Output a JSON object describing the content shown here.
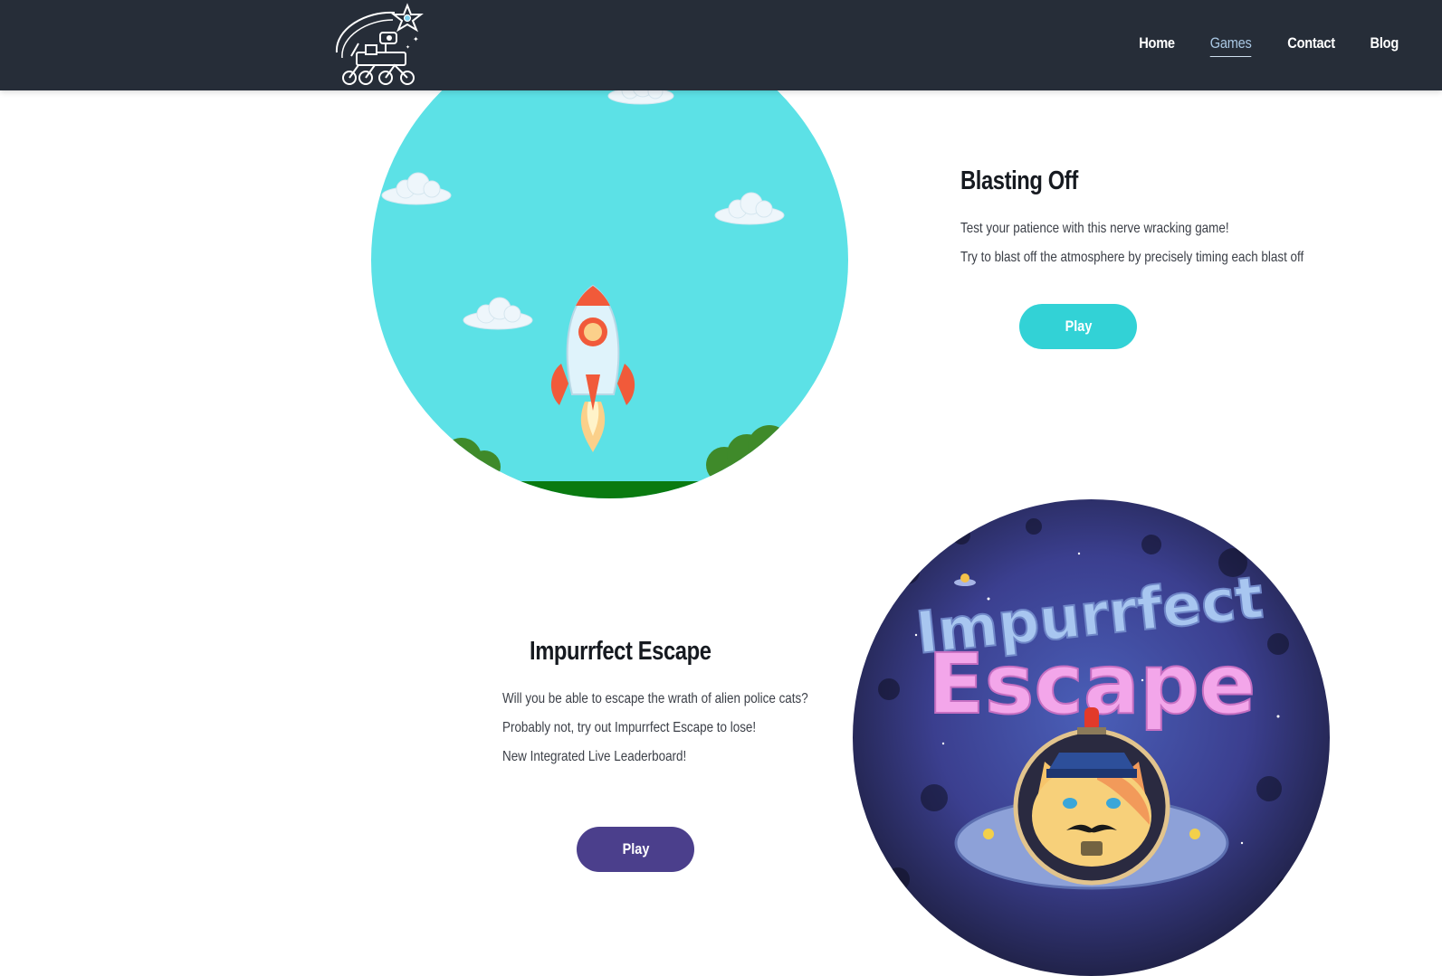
{
  "nav": {
    "logo_alt": "Rover logo",
    "links": [
      {
        "label": "Home",
        "active": false
      },
      {
        "label": "Games",
        "active": true
      },
      {
        "label": "Contact",
        "active": false
      },
      {
        "label": "Blog",
        "active": false
      }
    ]
  },
  "games": [
    {
      "title": "Blasting Off",
      "description": [
        "Test your patience with this nerve wracking game!",
        "Try to blast off the atmosphere by precisely timing each blast off"
      ],
      "play_label": "Play",
      "button_color": "#32d2d6"
    },
    {
      "title": "Impurrfect Escape",
      "description": [
        "Will you be able to escape the wrath of alien police cats?",
        "Probably not, try out Impurrfect Escape to lose!",
        "New Integrated Live Leaderboard!"
      ],
      "play_label": "Play",
      "button_color": "#4b3f8c",
      "art_text": [
        "Impurrfect",
        "Escape"
      ]
    }
  ],
  "colors": {
    "navbar_bg": "#262d38",
    "active_link": "#a9c7e3",
    "sky": "#5ce1e6"
  }
}
